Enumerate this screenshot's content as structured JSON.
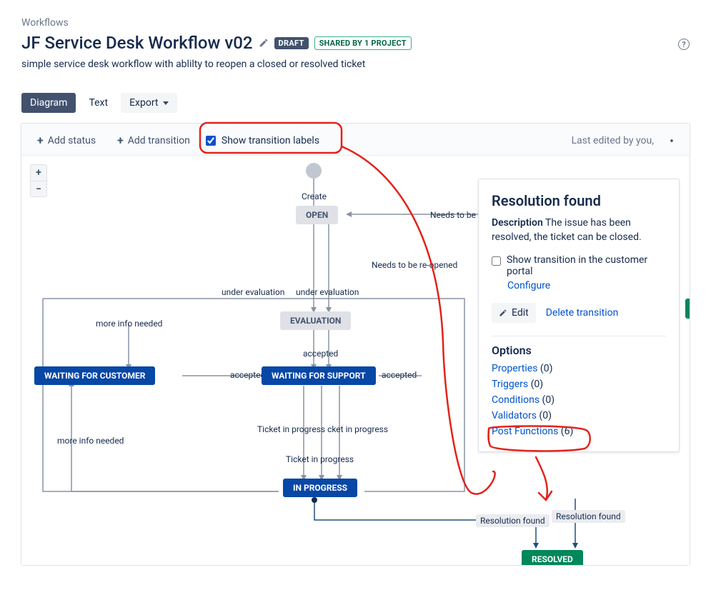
{
  "breadcrumb": "Workflows",
  "page_title": "JF Service Desk Workflow v02",
  "draft_badge": "DRAFT",
  "shared_badge": "SHARED BY 1 PROJECT",
  "description": "simple service desk workflow with ablilty to reopen a closed or resolved ticket",
  "view_tabs": {
    "diagram": "Diagram",
    "text": "Text",
    "export": "Export"
  },
  "toolbar": {
    "add_status": "Add status",
    "add_transition": "Add transition",
    "show_labels": "Show transition labels",
    "last_edited": "Last edited by you,"
  },
  "nodes": {
    "create": "Create",
    "open": "OPEN",
    "evaluation": "EVALUATION",
    "waiting_customer": "WAITING FOR CUSTOMER",
    "waiting_support": "WAITING FOR SUPPORT",
    "in_progress": "IN PROGRESS",
    "resolved": "RESOLVED"
  },
  "transitions": {
    "needs_reopen_top": "Needs to be re",
    "needs_reopen": "Needs to be re-opened",
    "under_eval_l": "under evaluation",
    "under_eval_r": "under evaluation",
    "more_info_top": "more info needed",
    "more_info_bottom": "more info needed",
    "accepted_l": "accepted",
    "accepted_c": "accepted",
    "accepted_r": "accepted",
    "tip_row": "Ticket in progress cket in progress",
    "tip_single": "Ticket in progress",
    "res_found_l": "Resolution found",
    "res_found_r": "Resolution found"
  },
  "panel": {
    "title": "Resolution found",
    "desc_label": "Description",
    "desc_text": "The issue has been resolved, the ticket can be closed.",
    "show_cust": "Show transition in the customer portal",
    "configure": "Configure",
    "edit": "Edit",
    "delete": "Delete transition",
    "options_h": "Options",
    "props": "Properties",
    "props_c": "(0)",
    "triggers": "Triggers",
    "triggers_c": "(0)",
    "conds": "Conditions",
    "conds_c": "(0)",
    "vals": "Validators",
    "vals_c": "(0)",
    "pfs": "Post Functions",
    "pfs_c": "(6)"
  }
}
